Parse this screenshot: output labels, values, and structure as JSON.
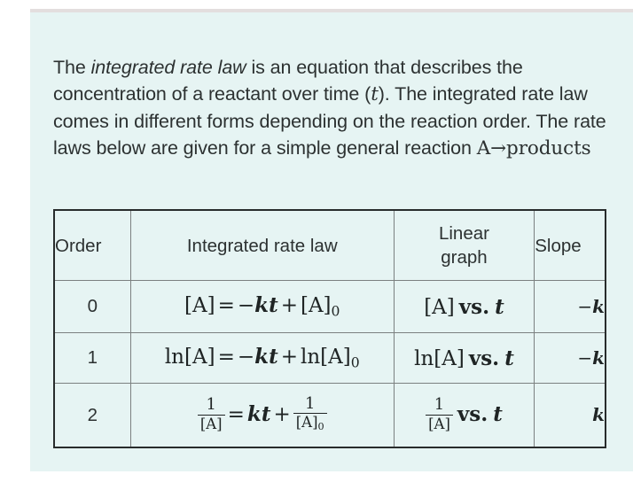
{
  "panel": {
    "background_color": "#e6f4f3",
    "top_strip_color": "#e3dede"
  },
  "intro": {
    "part1": "The ",
    "emphasis": "integrated rate law",
    "part2": " is an equation that describes the concentration of a reactant over time (",
    "variable_t": "t",
    "part3": "). The integrated rate law comes in different forms depending on the reaction order. The rate laws below are given for a simple general reaction ",
    "reaction": "A→products"
  },
  "table": {
    "headers": {
      "order": "Order",
      "integrated_rate_law": "Integrated rate law",
      "linear_graph_line1": "Linear",
      "linear_graph_line2": "graph",
      "slope": "Slope"
    },
    "border_color_outer": "#282c2c",
    "border_color_inner": "#7b8080",
    "rows": [
      {
        "order": "0",
        "law_plain": "[A] = −kt + [A]₀",
        "law": {
          "lhs": "[A]",
          "equals": "=",
          "minus": "−",
          "k": "k",
          "t": "t",
          "plus": "+",
          "rhs_bracket": "[A]",
          "rhs_sub": "0"
        },
        "graph_plain": "[A] vs. t",
        "graph": {
          "quantity": "[A]",
          "vs": "vs.",
          "variable": "t"
        },
        "slope": "−k",
        "slope_sign": "−",
        "slope_symbol": "k"
      },
      {
        "order": "1",
        "law_plain": "ln[A] = −kt + ln[A]₀",
        "law": {
          "lhs": "ln[A]",
          "equals": "=",
          "minus": "−",
          "k": "k",
          "t": "t",
          "plus": "+",
          "rhs_bracket": "ln[A]",
          "rhs_sub": "0"
        },
        "graph_plain": "ln[A] vs. t",
        "graph": {
          "quantity": "ln[A]",
          "vs": "vs.",
          "variable": "t"
        },
        "slope": "−k",
        "slope_sign": "−",
        "slope_symbol": "k"
      },
      {
        "order": "2",
        "law_plain": "1/[A] = kt + 1/[A]₀",
        "law": {
          "lhs_num": "1",
          "lhs_den": "[A]",
          "equals": "=",
          "k": "k",
          "t": "t",
          "plus": "+",
          "rhs_num": "1",
          "rhs_den": "[A]",
          "rhs_sub": "0"
        },
        "graph_plain": "1/[A] vs. t",
        "graph": {
          "num": "1",
          "den": "[A]",
          "vs": "vs.",
          "variable": "t"
        },
        "slope": "k",
        "slope_sign": "",
        "slope_symbol": "k"
      }
    ]
  }
}
